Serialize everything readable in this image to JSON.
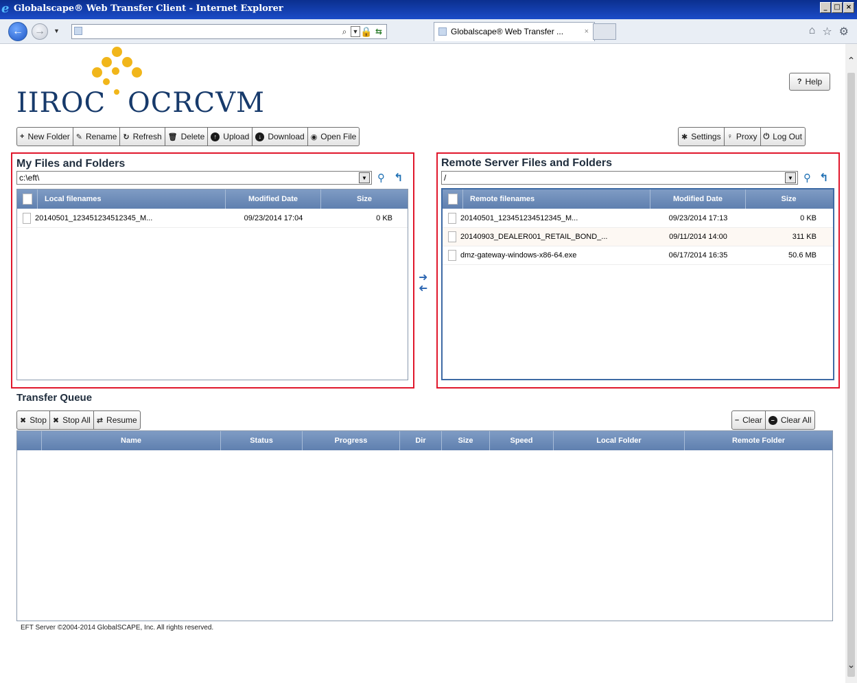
{
  "browser": {
    "title": "Globalscape® Web Transfer Client - Internet Explorer",
    "window_buttons": [
      "_",
      "□",
      "×"
    ],
    "address_value": "",
    "tab_label": "Globalscape® Web Transfer ...",
    "tab_close": "×"
  },
  "logo": {
    "part1": "IIROC",
    "part2": "OCRCVM"
  },
  "toolbar": {
    "new_folder": "New Folder",
    "rename": "Rename",
    "refresh": "Refresh",
    "delete": "Delete",
    "upload": "Upload",
    "download": "Download",
    "open_file": "Open File",
    "settings": "Settings",
    "proxy": "Proxy",
    "log_out": "Log Out",
    "help": "Help"
  },
  "local": {
    "title": "My Files and Folders",
    "path": "c:\\eft\\",
    "columns": [
      "Local filenames",
      "Modified Date",
      "Size"
    ],
    "rows": [
      {
        "name": "20140501_123451234512345_M...",
        "date": "09/23/2014 17:04",
        "size": "0 KB"
      }
    ]
  },
  "remote": {
    "title": "Remote Server Files and Folders",
    "path": "/",
    "columns": [
      "Remote filenames",
      "Modified Date",
      "Size"
    ],
    "rows": [
      {
        "name": "20140501_123451234512345_M...",
        "date": "09/23/2014 17:13",
        "size": "0 KB"
      },
      {
        "name": "20140903_DEALER001_RETAIL_BOND_...",
        "date": "09/11/2014 14:00",
        "size": "311 KB"
      },
      {
        "name": "dmz-gateway-windows-x86-64.exe",
        "date": "06/17/2014 16:35",
        "size": "50.6 MB"
      }
    ]
  },
  "queue": {
    "title": "Transfer Queue",
    "stop": "Stop",
    "stop_all": "Stop All",
    "resume": "Resume",
    "clear": "Clear",
    "clear_all": "Clear All",
    "columns": [
      "Name",
      "Status",
      "Progress",
      "Dir",
      "Size",
      "Speed",
      "Local Folder",
      "Remote Folder"
    ]
  },
  "footer": "EFT Server ©2004-2014 GlobalSCAPE, Inc. All rights reserved.",
  "colors": {
    "accent_red": "#e0162b",
    "header_blue": "#5f80af",
    "logo_gold": "#f1b61a",
    "logo_navy": "#173a6b"
  }
}
